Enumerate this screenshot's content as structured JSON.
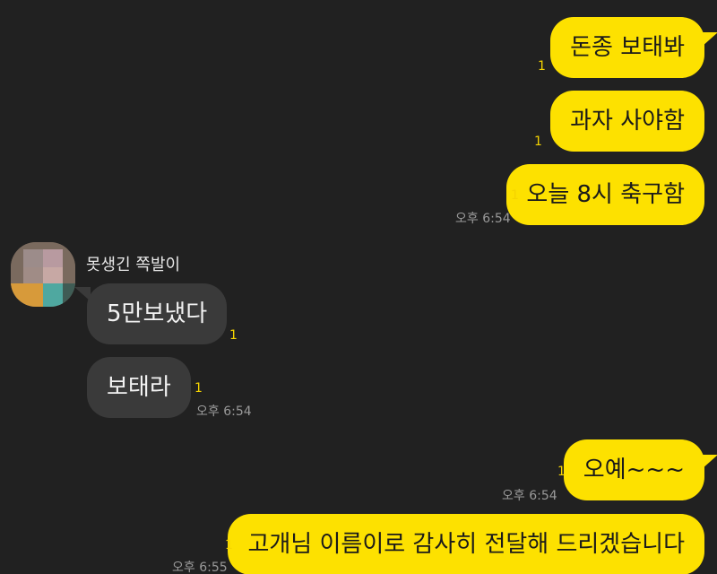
{
  "chat": {
    "messages": [
      {
        "text": "돈종 보태봐",
        "unread": "1"
      },
      {
        "text": "과자 사야함",
        "unread": "1"
      },
      {
        "text": "오늘 8시 축구함",
        "unread": "1",
        "time": "오후 6:54"
      },
      {
        "text": "5만보냈다",
        "unread": "1"
      },
      {
        "text": "보태라",
        "unread": "1",
        "time": "오후 6:54"
      },
      {
        "text": "오예~~~",
        "unread": "1",
        "time": "오후 6:54"
      },
      {
        "text": "고개님 이름이로 감사히 전달해 드리겠습니다",
        "unread": "1",
        "time": "오후 6:55"
      }
    ],
    "sender_name": "못생긴 쪽발이"
  },
  "colors": {
    "background": "#212121",
    "my_bubble": "#fde100",
    "other_bubble": "#3a3a3a",
    "unread_count": "#f5d400",
    "timestamp": "#9a9a9a"
  }
}
